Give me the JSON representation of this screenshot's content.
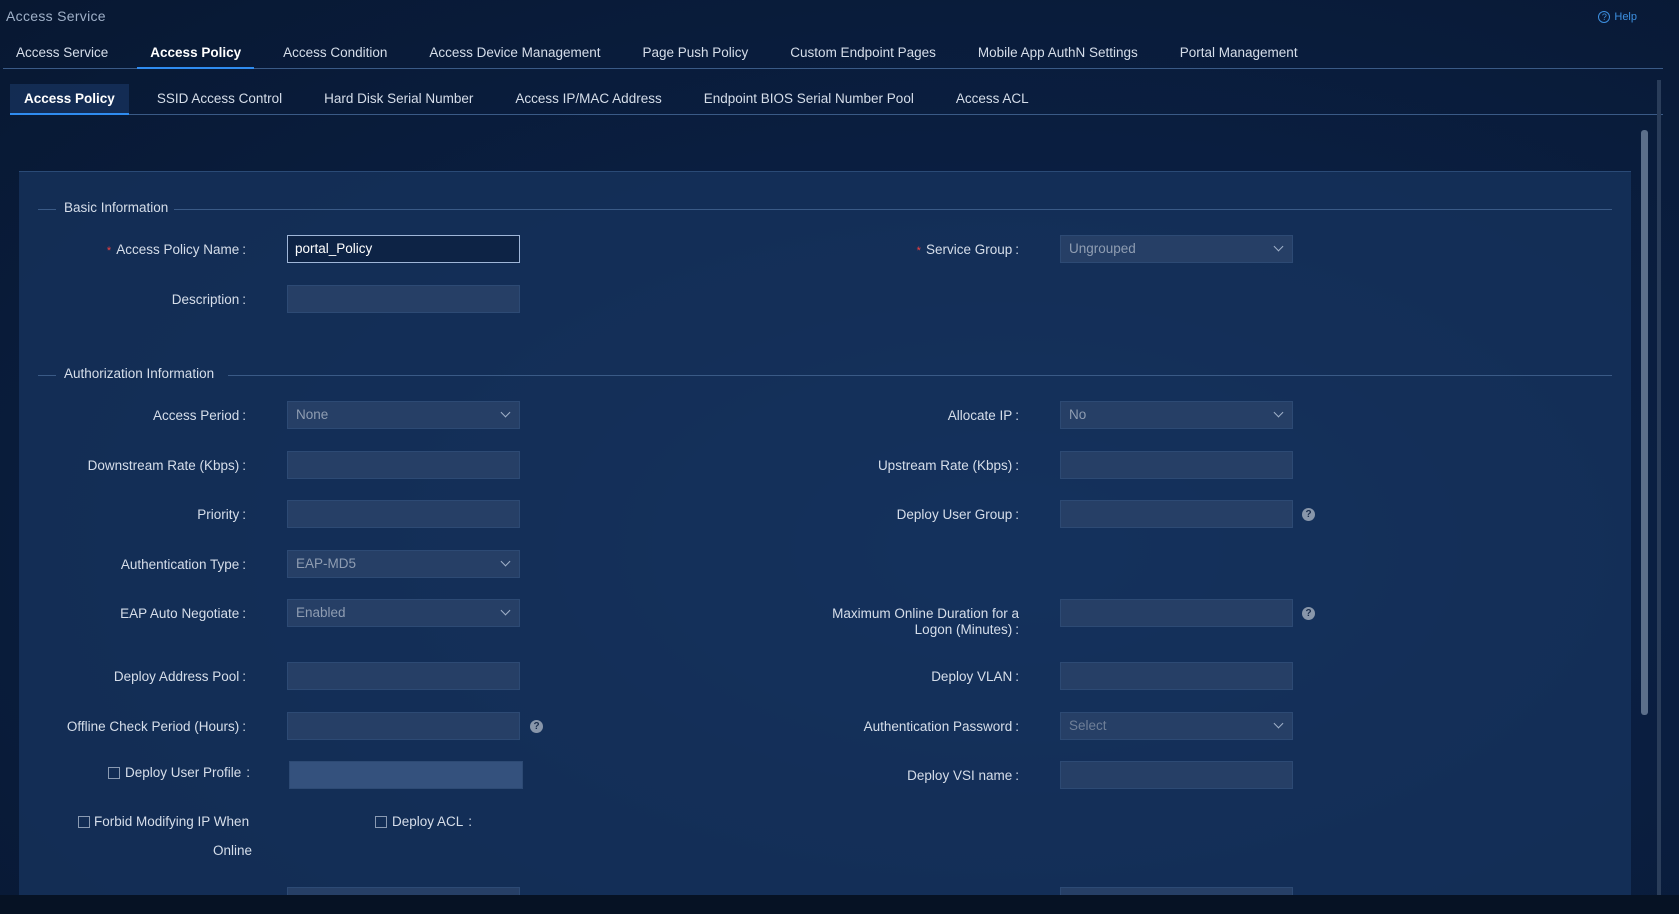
{
  "app": {
    "title": "Access Service",
    "help_label": "Help"
  },
  "tabs_main": [
    {
      "label": "Access Service"
    },
    {
      "label": "Access Policy"
    },
    {
      "label": "Access Condition"
    },
    {
      "label": "Access Device Management"
    },
    {
      "label": "Page Push Policy"
    },
    {
      "label": "Custom Endpoint Pages"
    },
    {
      "label": "Mobile App AuthN Settings"
    },
    {
      "label": "Portal Management"
    }
  ],
  "tabs_sub": [
    {
      "label": "Access Policy"
    },
    {
      "label": "SSID Access Control"
    },
    {
      "label": "Hard Disk Serial Number"
    },
    {
      "label": "Access IP/MAC Address"
    },
    {
      "label": "Endpoint BIOS Serial Number Pool"
    },
    {
      "label": "Access ACL"
    }
  ],
  "basic": {
    "section_title": "Basic Information",
    "policy_name_label": "Access Policy Name",
    "policy_name_value": "portal_Policy",
    "service_group_label": "Service Group",
    "service_group_value": "Ungrouped",
    "description_label": "Description",
    "required_mark": "*",
    "colon": ":"
  },
  "auth": {
    "section_title": "Authorization Information",
    "access_period_label": "Access Period",
    "access_period_value": "None",
    "allocate_ip_label": "Allocate IP",
    "allocate_ip_value": "No",
    "downstream_label": "Downstream Rate (Kbps)",
    "upstream_label": "Upstream Rate (Kbps)",
    "priority_label": "Priority",
    "deploy_user_group_label": "Deploy User Group",
    "auth_type_label": "Authentication Type",
    "auth_type_value": "EAP-MD5",
    "eap_auto_label": "EAP Auto Negotiate",
    "eap_auto_value": "Enabled",
    "max_online_label_1": "Maximum Online Duration for a",
    "max_online_label_2": "Logon (Minutes)",
    "deploy_address_pool_label": "Deploy Address Pool",
    "deploy_vlan_label": "Deploy VLAN",
    "offline_check_label": "Offline Check Period (Hours)",
    "auth_password_label": "Authentication Password",
    "auth_password_placeholder": "Select",
    "deploy_user_profile_label": "Deploy User Profile",
    "deploy_vsi_label": "Deploy VSI name",
    "forbid_ip_label_1": "Forbid Modifying IP When",
    "forbid_ip_label_2": "Online",
    "deploy_acl_label": "Deploy ACL",
    "help_glyph": "?"
  }
}
